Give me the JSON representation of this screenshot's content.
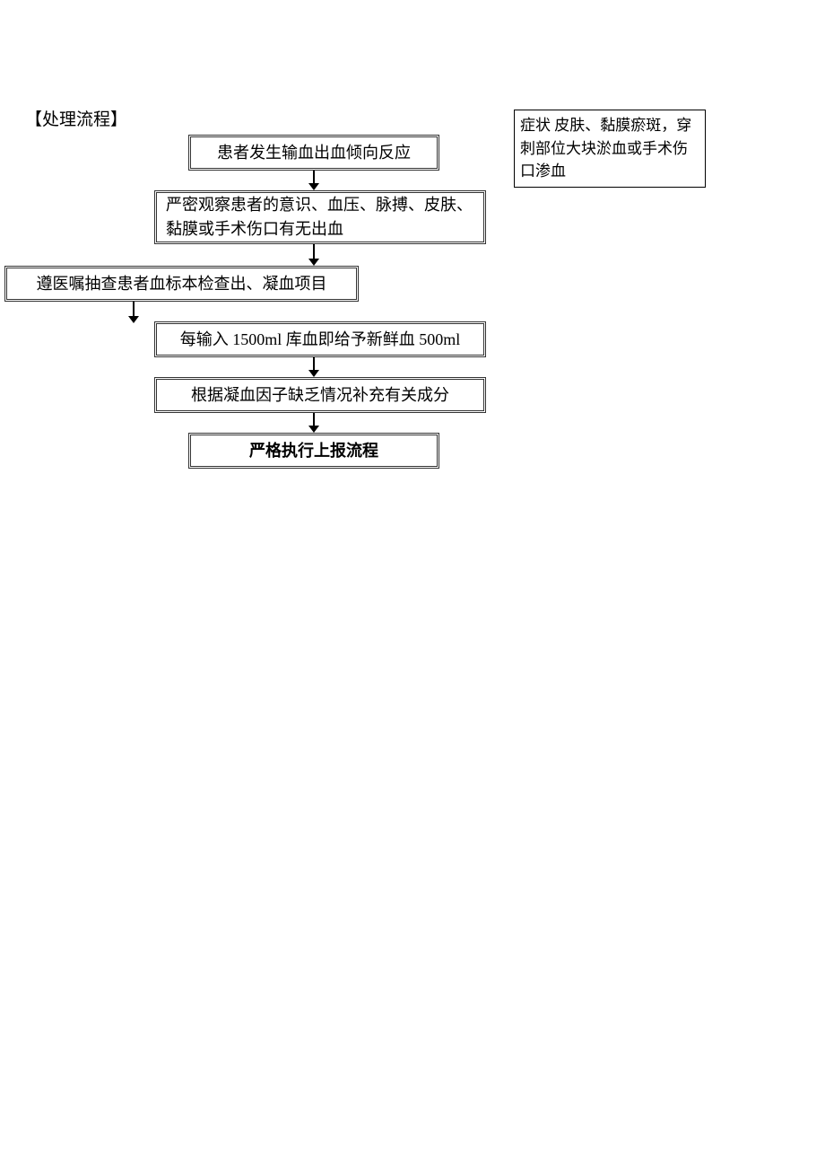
{
  "title": "【处理流程】",
  "flowchart": {
    "nodes": [
      {
        "id": "n1",
        "text": "患者发生输血出血倾向反应"
      },
      {
        "id": "n2",
        "text": "严密观察患者的意识、血压、脉搏、皮肤、黏膜或手术伤口有无出血"
      },
      {
        "id": "n3",
        "text": "遵医嘱抽查患者血标本检查出、凝血项目"
      },
      {
        "id": "n4",
        "text": "每输入 1500ml 库血即给予新鲜血 500ml"
      },
      {
        "id": "n5",
        "text": "根据凝血因子缺乏情况补充有关成分"
      },
      {
        "id": "n6",
        "text": "严格执行上报流程"
      }
    ],
    "edges": [
      {
        "from": "n1",
        "to": "n2"
      },
      {
        "from": "n2",
        "to": "n3"
      },
      {
        "from": "n3",
        "to": "n4"
      },
      {
        "from": "n4",
        "to": "n5"
      },
      {
        "from": "n5",
        "to": "n6"
      }
    ],
    "annotation": {
      "text": "症状 皮肤、黏膜瘀斑，穿刺部位大块淤血或手术伤口渗血"
    }
  }
}
